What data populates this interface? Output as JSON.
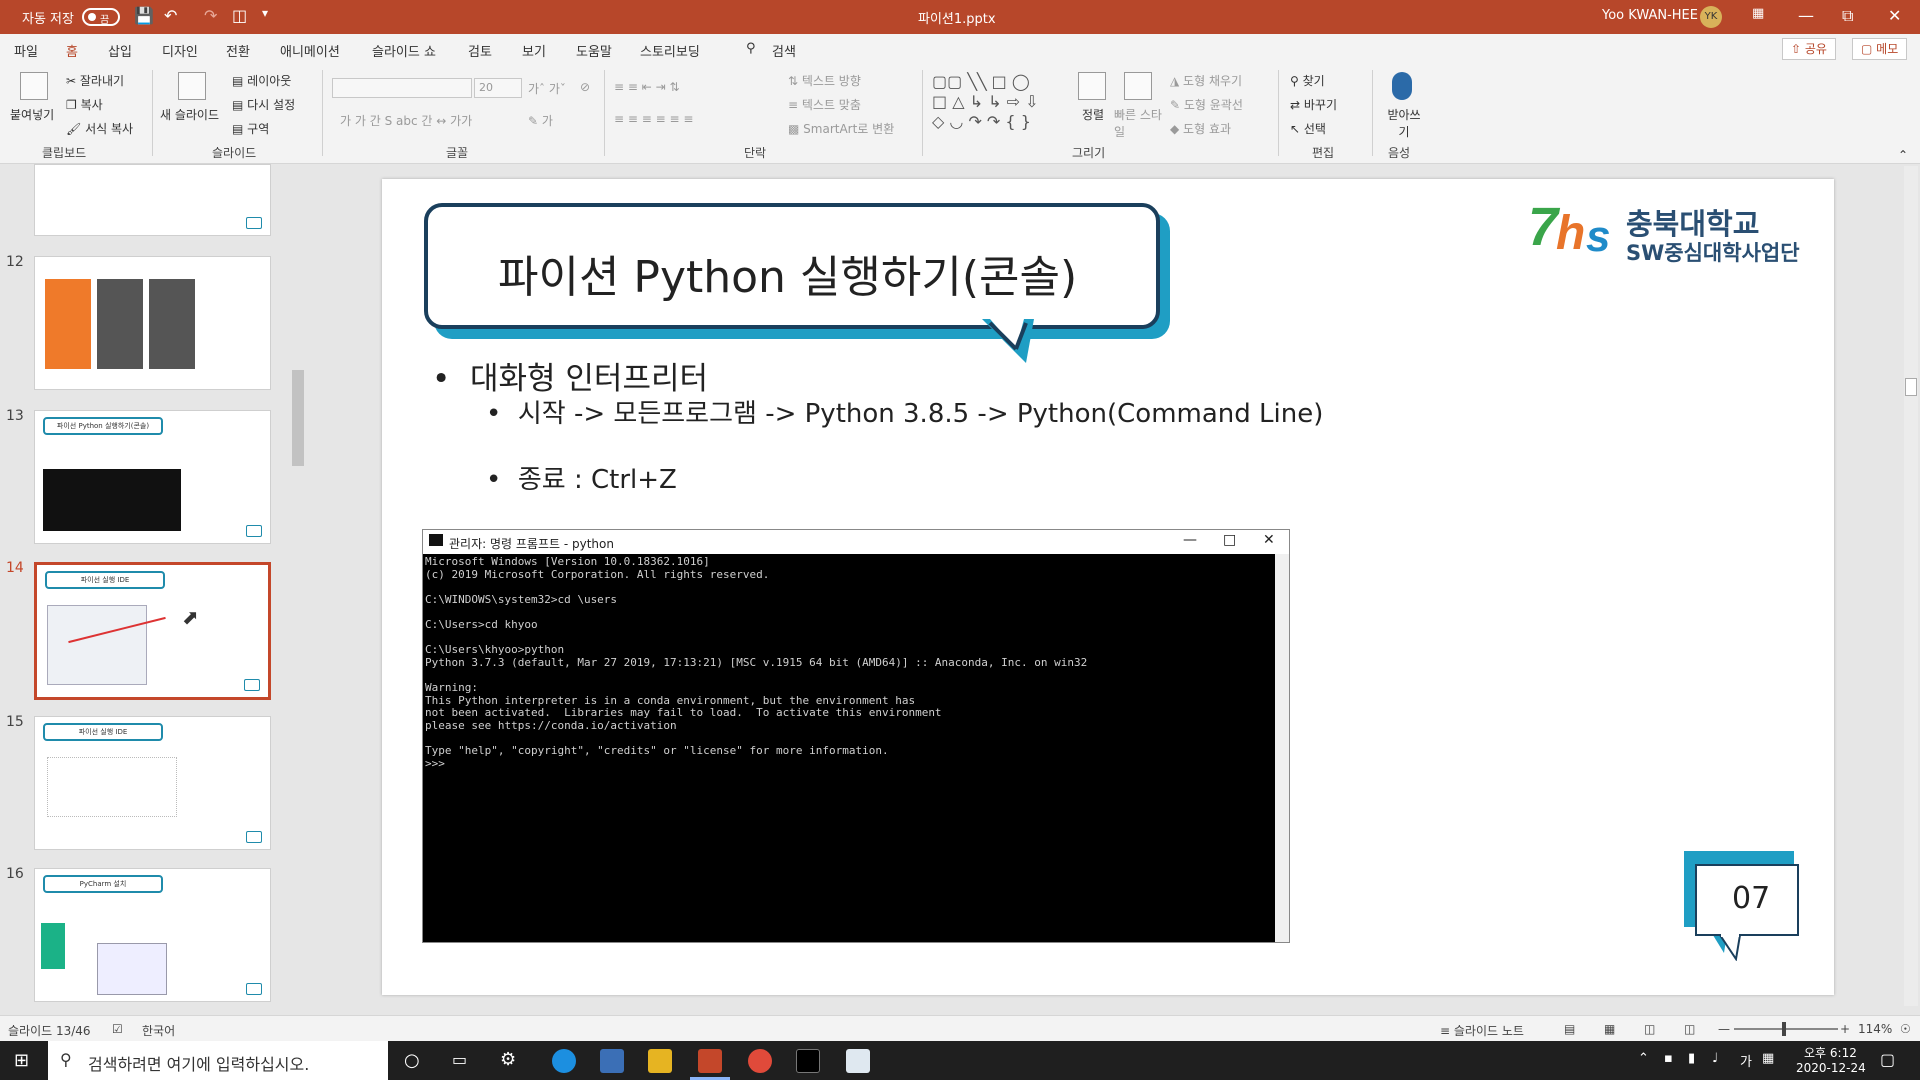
{
  "titlebar": {
    "autosave_label": "자동 저장",
    "autosave_state": "끔",
    "file_name": "파이션1.pptx",
    "user_name": "Yoo KWAN-HEE",
    "user_initials": "YK"
  },
  "menu": {
    "tabs": [
      "파일",
      "홈",
      "삽입",
      "디자인",
      "전환",
      "애니메이션",
      "슬라이드 쇼",
      "검토",
      "보기",
      "도움말",
      "스토리보딩"
    ],
    "search": "검색",
    "share": "공유",
    "comments": "메모"
  },
  "ribbon": {
    "clipboard": {
      "paste": "붙여넣기",
      "cut": "잘라내기",
      "copy": "복사",
      "format_painter": "서식 복사",
      "label": "클립보드"
    },
    "slides": {
      "new_slide": "새 슬라이드",
      "layout": "레이아웃",
      "reset": "다시 설정",
      "section": "구역",
      "label": "슬라이드"
    },
    "font": {
      "size": "20",
      "label": "글꼴"
    },
    "paragraph": {
      "text_direction": "텍스트 방향",
      "align_text": "텍스트 맞춤",
      "smartart": "SmartArt로 변환",
      "label": "단락"
    },
    "drawing": {
      "arrange": "정렬",
      "quick_styles": "빠른 스타일",
      "fill": "도형 채우기",
      "outline": "도형 윤곽선",
      "effects": "도형 효과",
      "label": "그리기"
    },
    "editing": {
      "find": "찾기",
      "replace": "바꾸기",
      "select": "선택",
      "label": "편집"
    },
    "voice": {
      "dictate": "받아쓰기",
      "label": "음성"
    }
  },
  "thumbnails": [
    {
      "num": "12",
      "title": ""
    },
    {
      "num": "13",
      "title": "파이선 Python 실행하기(콘솔)"
    },
    {
      "num": "14",
      "title": "파이선 실행 IDE"
    },
    {
      "num": "15",
      "title": "파이선 실행 IDE"
    },
    {
      "num": "16",
      "title": "PyCharm 설치"
    }
  ],
  "slide": {
    "title": "파이션 Python 실행하기(콘솔)",
    "logo_line1": "충북대학교",
    "logo_line2": "SW중심대학사업단",
    "bullet_main": "대화형 인터프리터",
    "bullet_sub1": "시작 -> 모든프로그램 -> Python 3.8.5 -> Python(Command Line)",
    "bullet_sub2": "종료 : Ctrl+Z",
    "page_number": "07",
    "console": {
      "title": "관리자: 명령 프롬프트 - python",
      "lines": "Microsoft Windows [Version 10.0.18362.1016]\n(c) 2019 Microsoft Corporation. All rights reserved.\n\nC:\\WINDOWS\\system32>cd \\users\n\nC:\\Users>cd khyoo\n\nC:\\Users\\khyoo>python\nPython 3.7.3 (default, Mar 27 2019, 17:13:21) [MSC v.1915 64 bit (AMD64)] :: Anaconda, Inc. on win32\n\nWarning:\nThis Python interpreter is in a conda environment, but the environment has\nnot been activated.  Libraries may fail to load.  To activate this environment\nplease see https://conda.io/activation\n\nType \"help\", \"copyright\", \"credits\" or \"license\" for more information.\n>>>"
    }
  },
  "status": {
    "slide_counter": "슬라이드 13/46",
    "language": "한국어",
    "notes": "슬라이드 노트",
    "zoom": "114%"
  },
  "taskbar": {
    "search_placeholder": "검색하려면 여기에 입력하십시오.",
    "time": "오후 6:12",
    "date": "2020-12-24",
    "ime": "가"
  }
}
